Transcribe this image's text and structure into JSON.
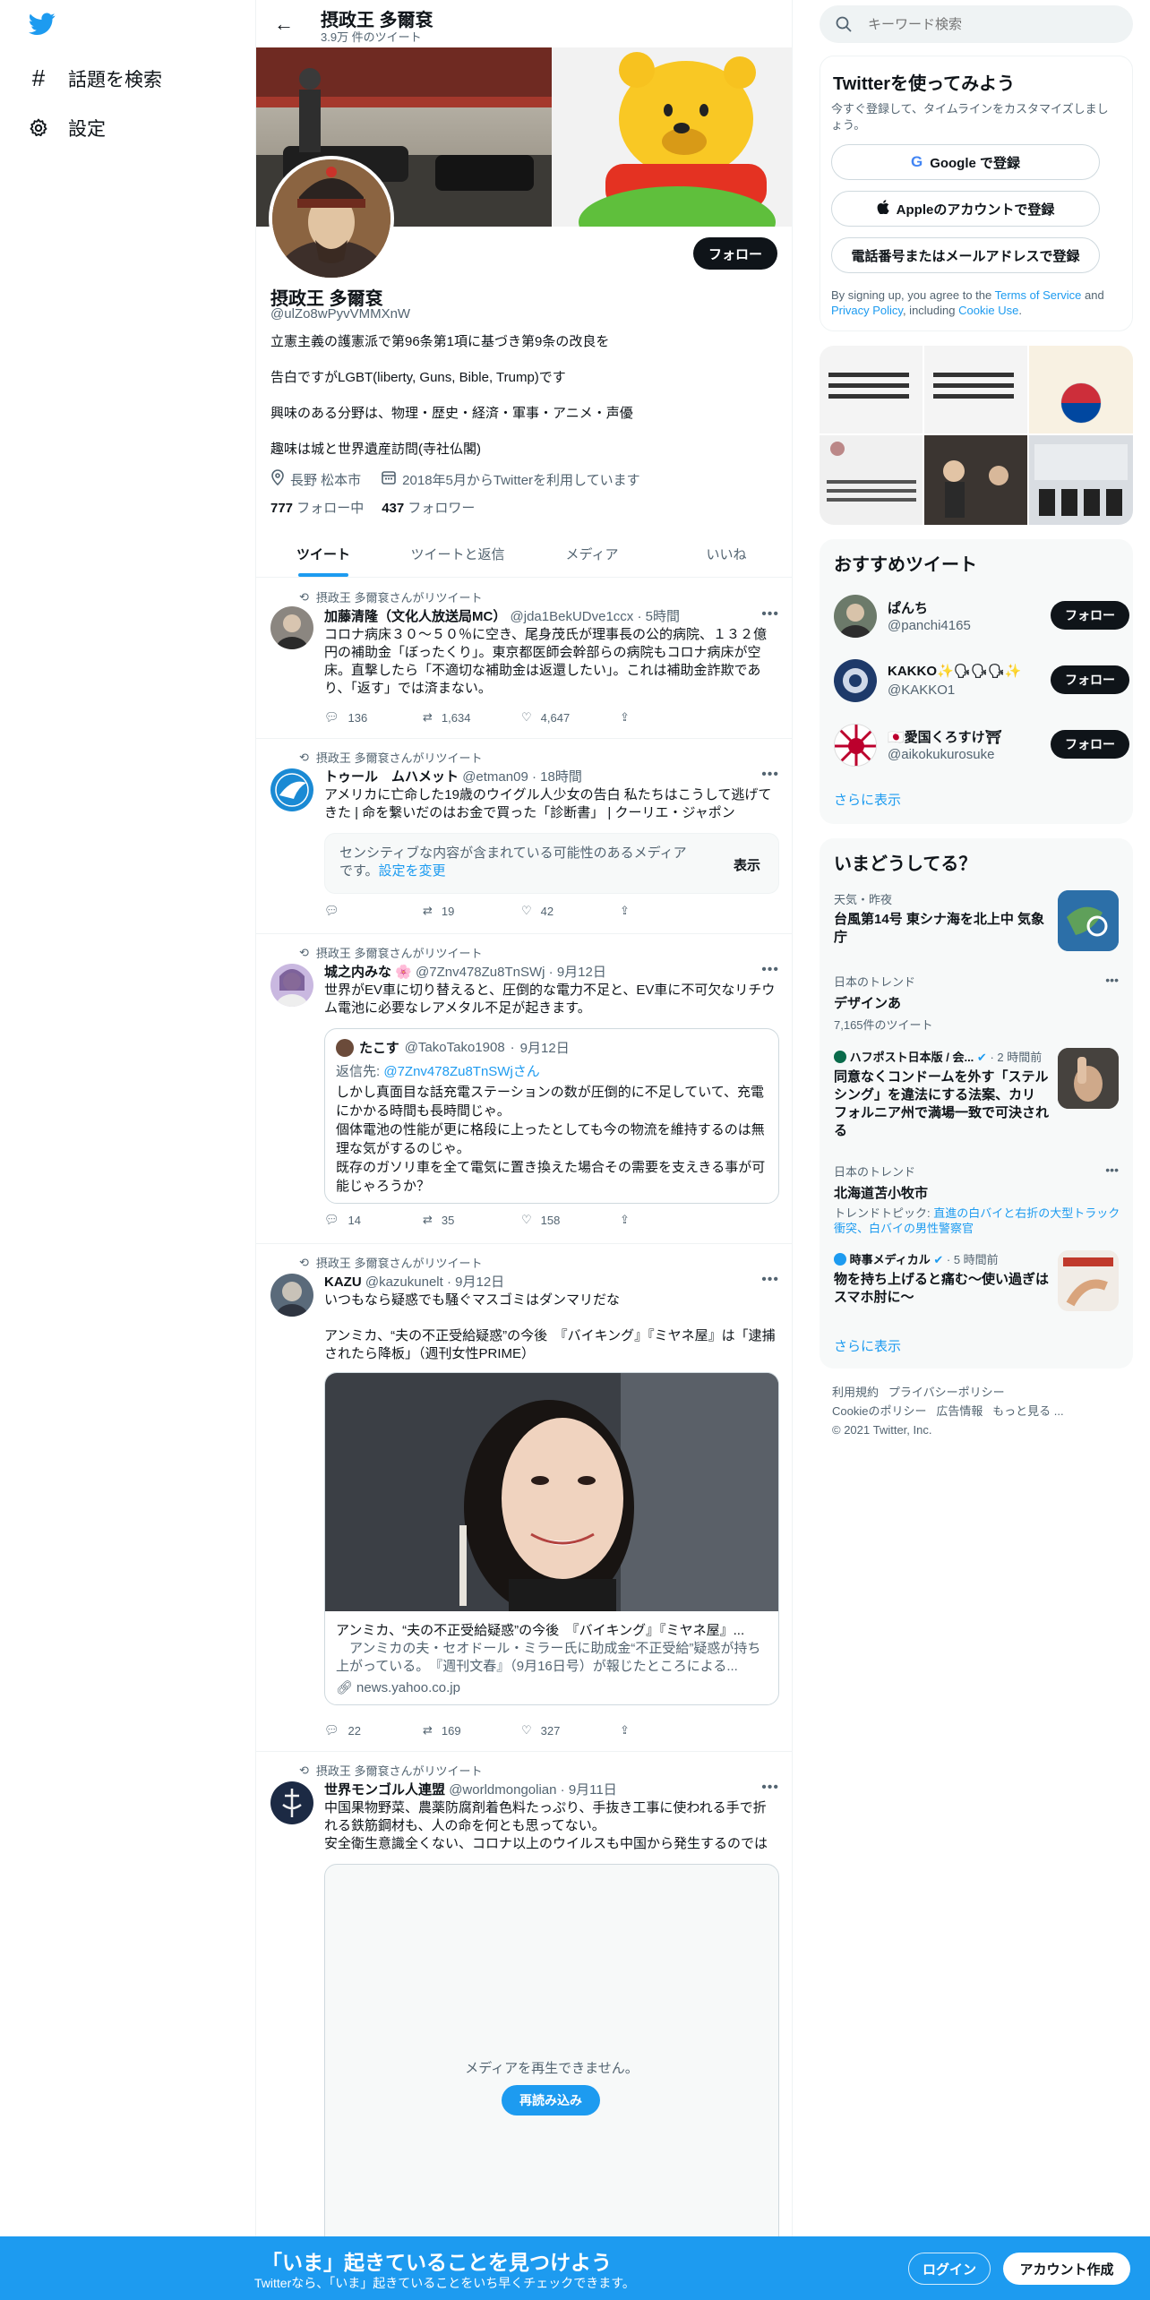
{
  "nav": {
    "explore_label": "話題を検索",
    "settings_label": "設定"
  },
  "header": {
    "name": "摂政王 多爾袞",
    "tweet_count": "3.9万 件のツイート"
  },
  "profile": {
    "name": "摂政王 多爾袞",
    "handle": "@ulZo8wPyvVMMXnW",
    "follow_label": "フォロー",
    "bio_lines": [
      "立憲主義の護憲派で第96条第1項に基づき第9条の改良を",
      "告白ですがLGBT(liberty, Guns, Bible, Trump)です",
      "興味のある分野は、物理・歴史・経済・軍事・アニメ・声優",
      "趣味は城と世界遺産訪問(寺社仏閣)"
    ],
    "location": "長野 松本市",
    "joined": "2018年5月からTwitterを利用しています",
    "following_count": "777",
    "following_label": "フォロー中",
    "followers_count": "437",
    "followers_label": "フォロワー"
  },
  "tabs": [
    "ツイート",
    "ツイートと返信",
    "メディア",
    "いいね"
  ],
  "tweets": [
    {
      "retweeted_by": "摂政王 多爾袞さんがリツイート",
      "name": "加藤清隆（文化人放送局MC）",
      "handle": "@jda1BekUDve1ccx",
      "time": "5時間",
      "text": "コロナ病床３０～５０％に空き、尾身茂氏が理事長の公的病院、１３２億円の補助金「ぼったくり」。東京都医師会幹部らの病院もコロナ病床が空床。直撃したら「不適切な補助金は返還したい」。これは補助金詐欺であり、「返す」では済まない。",
      "replies": "136",
      "retweets": "1,634",
      "likes": "4,647"
    },
    {
      "retweeted_by": "摂政王 多爾袞さんがリツイート",
      "name": "トゥール　ムハメット",
      "handle": "@etman09",
      "time": "18時間",
      "text": "アメリカに亡命した19歳のウイグル人少女の告白 私たちはこうして逃げてきた | 命を繋いだのはお金で買った「診断書」 | クーリエ・ジャポン",
      "sensitive_text": "センシティブな内容が含まれている可能性のあるメディアです。",
      "sensitive_link": "設定を変更",
      "sensitive_button": "表示",
      "replies": "",
      "retweets": "19",
      "likes": "42"
    },
    {
      "retweeted_by": "摂政王 多爾袞さんがリツイート",
      "name": "城之内みな",
      "handle": "@7Znv478Zu8TnSWj",
      "time": "9月12日",
      "text": "世界がEV車に切り替えると、圧倒的な電力不足と、EV車に不可欠なリチウム電池に必要なレアメタル不足が起きます。",
      "quote": {
        "name": "たこす",
        "handle": "@TakoTako1908",
        "time": "9月12日",
        "reply_to_prefix": "返信先: ",
        "reply_to": "@7Znv478Zu8TnSWjさん",
        "text": "しかし真面目な話充電ステーションの数が圧倒的に不足していて、充電にかかる時間も長時間じゃ。\n個体電池の性能が更に格段に上ったとしても今の物流を維持するのは無理な気がするのじゃ。\n既存のガソリ車を全て電気に置き換えた場合その需要を支えきる事が可能じゃろうか？"
      },
      "replies": "14",
      "retweets": "35",
      "likes": "158"
    },
    {
      "retweeted_by": "摂政王 多爾袞さんがリツイート",
      "name": "KAZU",
      "handle": "@kazukunelt",
      "time": "9月12日",
      "text": "いつもなら疑惑でも騒ぐマスゴミはダンマリだな\n\nアンミカ、“夫の不正受給疑惑”の今後　『バイキング』『ミヤネ屋』は「逮捕されたら降板」（週刊女性PRIME）",
      "card": {
        "title": "アンミカ、“夫の不正受給疑惑”の今後　『バイキング』『ミヤネ屋』...",
        "desc": "　アンミカの夫・セオドール・ミラー氏に助成金“不正受給”疑惑が持ち上がっている。　『週刊文春』（9月16日号）が報じたところによる...",
        "domain": "news.yahoo.co.jp"
      },
      "replies": "22",
      "retweets": "169",
      "likes": "327"
    },
    {
      "retweeted_by": "摂政王 多爾袞さんがリツイート",
      "name": "世界モンゴル人連盟",
      "handle": "@worldmongolian",
      "time": "9月11日",
      "text": "中国果物野菜、農薬防腐剤着色料たっぷり、手抜き工事に使われる手で折れる鉄筋鋼材も、人の命を何とも思ってない。\n安全衛生意識全くない、コロナ以上のウイルスも中国から発生するのでは",
      "media_error": "メディアを再生できません。",
      "reload_label": "再読み込み"
    }
  ],
  "search": {
    "placeholder": "キーワード検索"
  },
  "signup": {
    "title": "Twitterを使ってみよう",
    "subtitle": "今すぐ登録して、タイムラインをカスタマイズしましょう。",
    "google": "Google で登録",
    "apple": "Appleのアカウントで登録",
    "phone": "電話番号またはメールアドレスで登録",
    "terms_pre": "By signing up, you agree to the ",
    "terms_link": "Terms of Service",
    "terms_mid": " and ",
    "privacy_link": "Privacy Policy",
    "terms_post": ", including ",
    "cookie_link": "Cookie Use",
    "terms_end": "."
  },
  "recommended": {
    "title": "おすすめツイート",
    "users": [
      {
        "name": "ぱんち",
        "handle": "@panchi4165",
        "follow": "フォロー"
      },
      {
        "name": "KAKKO✨🗣🗣🗣✨",
        "handle": "@KAKKO1",
        "follow": "フォロー"
      },
      {
        "name": "🇯🇵愛国くろすけ⛩",
        "handle": "@aikokukurosuke",
        "follow": "フォロー"
      }
    ],
    "show_more": "さらに表示"
  },
  "trends": {
    "title": "いまどうしてる？",
    "items": [
      {
        "context": "天気・昨夜",
        "title": "台風第14号 東シナ海を北上中 気象庁"
      },
      {
        "context": "日本のトレンド",
        "title": "デザインあ",
        "count": "7,165件のツイート"
      },
      {
        "context": "ハフポスト日本版 / 会...",
        "time": "2 時間前",
        "title": "同意なくコンドームを外す「ステルシング」を違法にする法案、カリフォルニア州で満場一致で可決される"
      },
      {
        "context": "日本のトレンド",
        "title": "北海道苫小牧市",
        "topic_label": "トレンドトピック: ",
        "topic": "直進の白バイと右折の大型トラック衝突、白バイの男性警察官"
      },
      {
        "context": "時事メディカル",
        "time": "5 時間前",
        "title": "物を持ち上げると痛む～使い過ぎはスマホ肘に～"
      }
    ],
    "show_more": "さらに表示"
  },
  "footer": {
    "links": [
      "利用規約",
      "プライバシーポリシー",
      "Cookieのポリシー",
      "広告情報",
      "もっと見る ..."
    ],
    "copyright": "© 2021 Twitter, Inc."
  },
  "bottom": {
    "title": "「いま」起きていることを見つけよう",
    "subtitle": "Twitterなら、「いま」起きていることをいち早くチェックできます。",
    "login": "ログイン",
    "signup": "アカウント作成"
  },
  "colors": {
    "accent": "#1d9bf0",
    "text": "#0f1419",
    "muted": "#536471"
  }
}
